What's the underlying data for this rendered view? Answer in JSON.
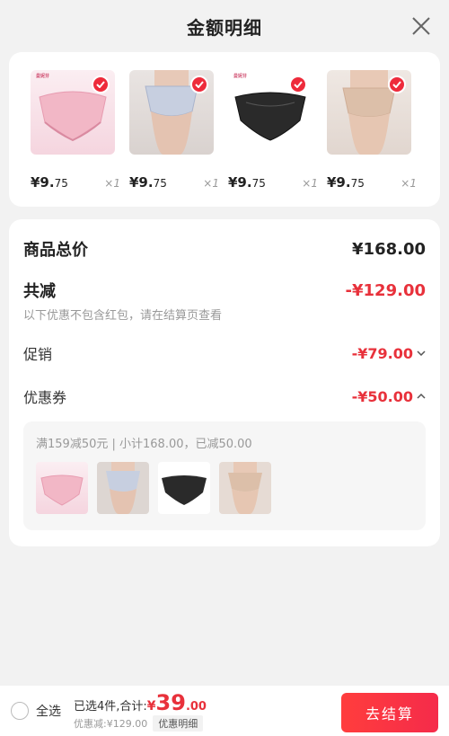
{
  "header": {
    "title": "金额明细"
  },
  "products": [
    {
      "price_int": "¥9.",
      "price_dec": "75",
      "qty": "×1",
      "image": "pink-lace-underwear",
      "brand": "曼妮芬 CULTURALE"
    },
    {
      "price_int": "¥9.",
      "price_dec": "75",
      "qty": "×1",
      "image": "light-blue-lace-model",
      "brand": ""
    },
    {
      "price_int": "¥9.",
      "price_dec": "75",
      "qty": "×1",
      "image": "black-lace-underwear",
      "brand": "曼妮芬 CULTURALE"
    },
    {
      "price_int": "¥9.",
      "price_dec": "75",
      "qty": "×1",
      "image": "nude-seamless-model",
      "brand": ""
    }
  ],
  "summary": {
    "total_label": "商品总价",
    "total_value": "¥168.00",
    "discount_label": "共减",
    "discount_value": "-¥129.00",
    "note": "以下优惠不包含红包，请在结算页查看",
    "promo_label": "促销",
    "promo_value": "-¥79.00",
    "coupon_label": "优惠券",
    "coupon_value": "-¥50.00",
    "promo_box_title": "满159减50元 | 小计168.00，已减50.00"
  },
  "bottom": {
    "select_all": "全选",
    "selected_text": "已选4件,合计:",
    "yen": "¥",
    "amount": "39",
    "amount_dec": ".00",
    "discounted": "优惠减:¥129.00",
    "detail": "优惠明细",
    "checkout": "去结算"
  },
  "colors": {
    "accent": "#e8313b",
    "check": "#ee2b3b"
  }
}
